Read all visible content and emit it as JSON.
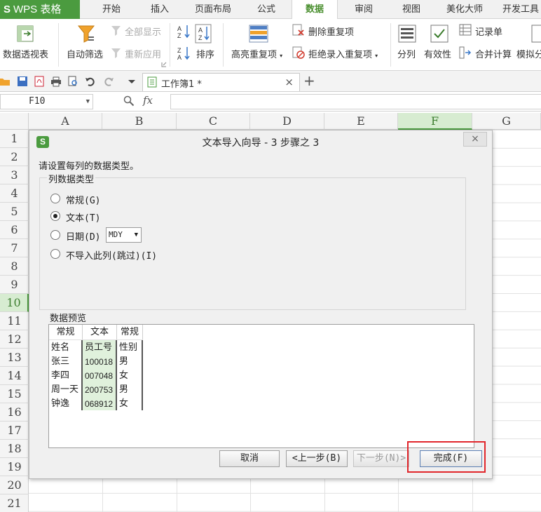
{
  "app": {
    "logo_mark": "S",
    "name": "WPS 表格"
  },
  "tabs": [
    {
      "label": "开始",
      "active": false
    },
    {
      "label": "插入",
      "active": false
    },
    {
      "label": "页面布局",
      "active": false
    },
    {
      "label": "公式",
      "active": false
    },
    {
      "label": "数据",
      "active": true
    },
    {
      "label": "审阅",
      "active": false
    },
    {
      "label": "视图",
      "active": false
    },
    {
      "label": "美化大师",
      "active": false
    },
    {
      "label": "开发工具",
      "active": false
    }
  ],
  "ribbon": {
    "pivot_table": "数据透视表",
    "auto_filter": "自动筛选",
    "show_all": "全部显示",
    "reapply": "重新应用",
    "sort": "排序",
    "highlight_dup": "高亮重复项",
    "delete_dup": "删除重复项",
    "reject_dup": "拒绝录入重复项",
    "split": "分列",
    "validity": "有效性",
    "record_list": "记录单",
    "merge_calc": "合并计算",
    "simulate": "模拟分"
  },
  "document": {
    "tab_label": "工作簿1 *",
    "close_glyph": "×",
    "new_tab_glyph": "+"
  },
  "formula_bar": {
    "name_box": "F10",
    "fx": "fx",
    "value": ""
  },
  "columns": [
    "A",
    "B",
    "C",
    "D",
    "E",
    "F",
    "G"
  ],
  "selected_column": "F",
  "rows": [
    "1",
    "2",
    "3",
    "4",
    "5",
    "6",
    "7",
    "8",
    "9",
    "10",
    "11",
    "12",
    "13",
    "14",
    "15",
    "16",
    "17",
    "18",
    "19",
    "20",
    "21"
  ],
  "selected_row": "10",
  "dialog": {
    "icon_letter": "S",
    "title": "文本导入向导 - 3 步骤之 3",
    "close_glyph": "×",
    "instruction": "请设置每列的数据类型。",
    "column_type_group": "列数据类型",
    "options": [
      {
        "label": "常规(G)",
        "selected": false
      },
      {
        "label": "文本(T)",
        "selected": true
      },
      {
        "label": "日期(D)",
        "selected": false
      },
      {
        "label": "不导入此列(跳过)(I)",
        "selected": false
      }
    ],
    "date_format": "MDY",
    "preview_group": "数据预览",
    "preview": {
      "headers": [
        "常规",
        "文本",
        "常规"
      ],
      "rows": [
        [
          "姓名",
          "员工号",
          "性别"
        ],
        [
          "张三",
          "100018",
          "男"
        ],
        [
          "李四",
          "007048",
          "女"
        ],
        [
          "周一天",
          "200753",
          "男"
        ],
        [
          "钟逸",
          "068912",
          "女"
        ]
      ]
    },
    "buttons": {
      "cancel": "取消",
      "back": "<上一步(B)",
      "next": "下一步(N)>",
      "finish": "完成(F)"
    }
  }
}
